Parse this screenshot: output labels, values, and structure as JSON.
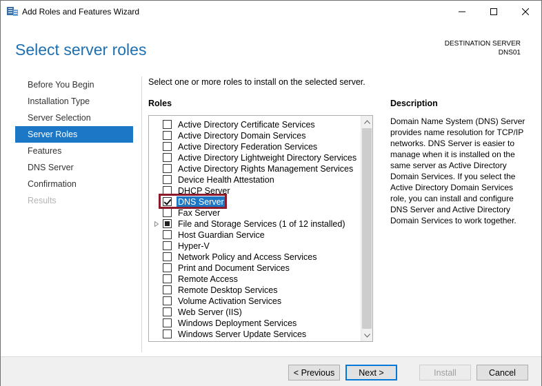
{
  "window": {
    "title": "Add Roles and Features Wizard",
    "minimize_icon": "minimize-icon",
    "maximize_icon": "maximize-icon",
    "close_icon": "close-icon"
  },
  "header": {
    "page_title": "Select server roles",
    "destination_label": "DESTINATION SERVER",
    "destination_server": "DNS01"
  },
  "nav": {
    "items": [
      {
        "label": "Before You Begin",
        "state": "normal"
      },
      {
        "label": "Installation Type",
        "state": "normal"
      },
      {
        "label": "Server Selection",
        "state": "normal"
      },
      {
        "label": "Server Roles",
        "state": "active"
      },
      {
        "label": "Features",
        "state": "normal"
      },
      {
        "label": "DNS Server",
        "state": "normal"
      },
      {
        "label": "Confirmation",
        "state": "normal"
      },
      {
        "label": "Results",
        "state": "disabled"
      }
    ]
  },
  "main": {
    "instruction": "Select one or more roles to install on the selected server.",
    "roles_heading": "Roles",
    "roles": [
      {
        "label": "Active Directory Certificate Services",
        "checked": "unchecked"
      },
      {
        "label": "Active Directory Domain Services",
        "checked": "unchecked"
      },
      {
        "label": "Active Directory Federation Services",
        "checked": "unchecked"
      },
      {
        "label": "Active Directory Lightweight Directory Services",
        "checked": "unchecked"
      },
      {
        "label": "Active Directory Rights Management Services",
        "checked": "unchecked"
      },
      {
        "label": "Device Health Attestation",
        "checked": "unchecked"
      },
      {
        "label": "DHCP Server",
        "checked": "unchecked"
      },
      {
        "label": "DNS Server",
        "checked": "checked",
        "selected": true
      },
      {
        "label": "Fax Server",
        "checked": "unchecked"
      },
      {
        "label": "File and Storage Services (1 of 12 installed)",
        "checked": "partial",
        "expandable": true
      },
      {
        "label": "Host Guardian Service",
        "checked": "unchecked"
      },
      {
        "label": "Hyper-V",
        "checked": "unchecked"
      },
      {
        "label": "Network Policy and Access Services",
        "checked": "unchecked"
      },
      {
        "label": "Print and Document Services",
        "checked": "unchecked"
      },
      {
        "label": "Remote Access",
        "checked": "unchecked"
      },
      {
        "label": "Remote Desktop Services",
        "checked": "unchecked"
      },
      {
        "label": "Volume Activation Services",
        "checked": "unchecked"
      },
      {
        "label": "Web Server (IIS)",
        "checked": "unchecked"
      },
      {
        "label": "Windows Deployment Services",
        "checked": "unchecked"
      },
      {
        "label": "Windows Server Update Services",
        "checked": "unchecked"
      }
    ],
    "description_heading": "Description",
    "description_text": "Domain Name System (DNS) Server provides name resolution for TCP/IP networks. DNS Server is easier to manage when it is installed on the same server as Active Directory Domain Services. If you select the Active Directory Domain Services role, you can install and configure DNS Server and Active Directory Domain Services to work together."
  },
  "footer": {
    "previous_label": "< Previous",
    "next_label": "Next >",
    "install_label": "Install",
    "cancel_label": "Cancel"
  },
  "colors": {
    "accent": "#1c78c6",
    "title": "#1e6fb0",
    "highlight_box": "#8b1a2a"
  }
}
